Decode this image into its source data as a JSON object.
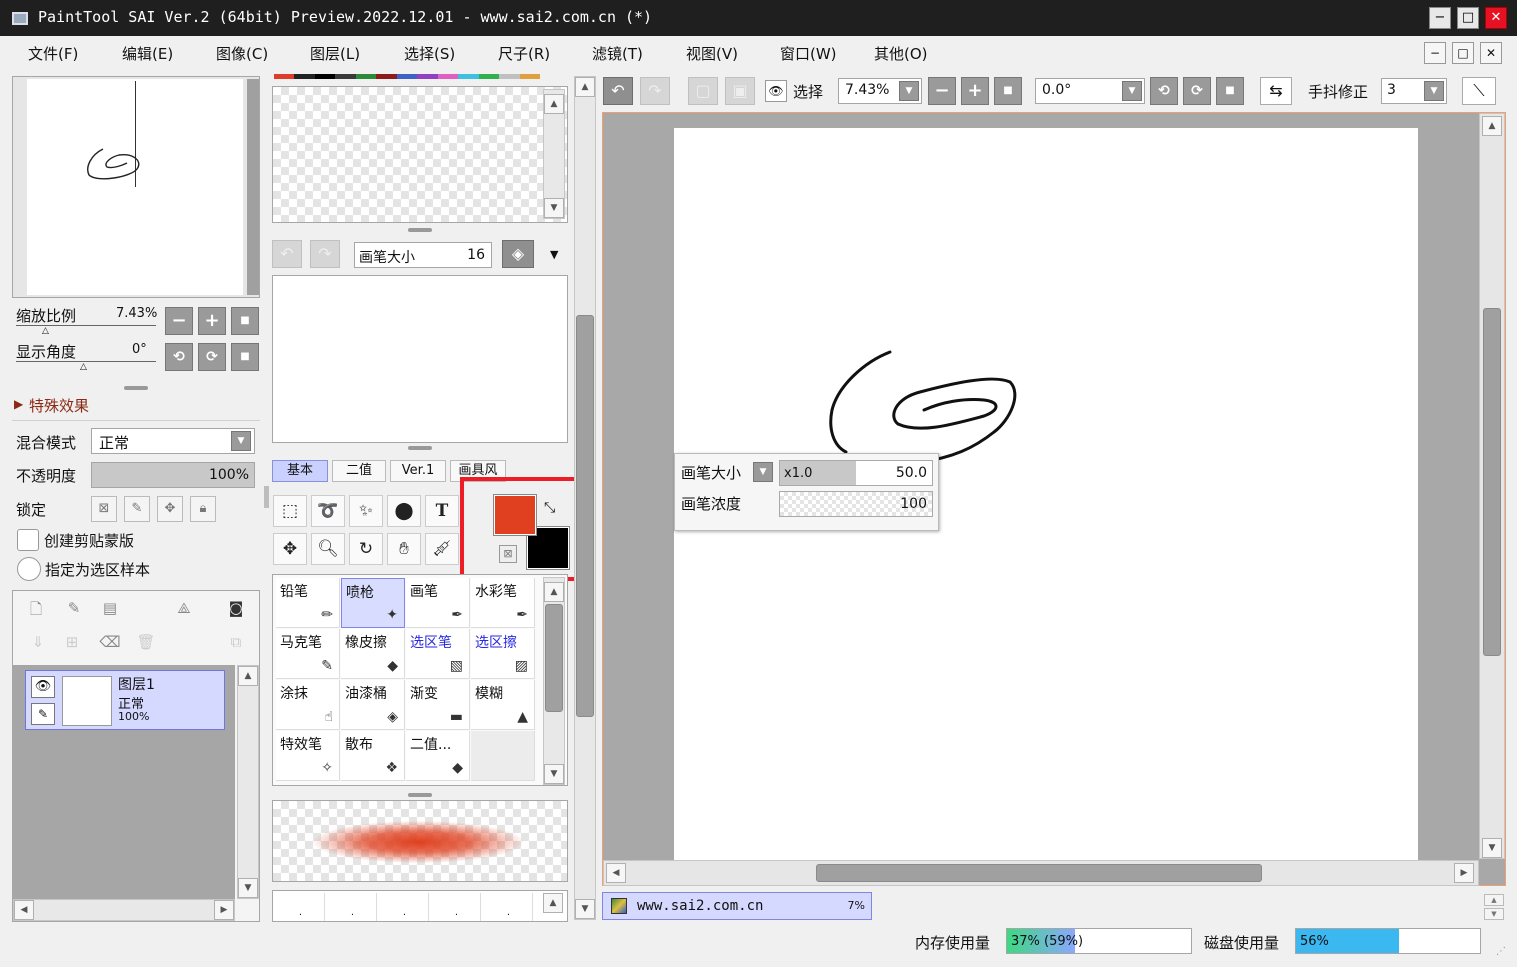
{
  "window": {
    "title": "PaintTool SAI Ver.2 (64bit) Preview.2022.12.01 - www.sai2.com.cn (*)",
    "min_glyph": "−",
    "max_glyph": "□",
    "close_glyph": "✕"
  },
  "menu": [
    "文件(F)",
    "编辑(E)",
    "图像(C)",
    "图层(L)",
    "选择(S)",
    "尺子(R)",
    "滤镜(T)",
    "视图(V)",
    "窗口(W)",
    "其他(O)"
  ],
  "navigator": {
    "zoom_label": "缩放比例",
    "zoom_value": "7.43%",
    "angle_label": "显示角度",
    "angle_value": "0°"
  },
  "effects": {
    "label": "特殊效果"
  },
  "layer_props": {
    "blend_label": "混合模式",
    "blend_value": "正常",
    "opacity_label": "不透明度",
    "opacity_value": "100%",
    "opacity_level": 1.0,
    "lock_label": "锁定",
    "clip_label": "创建剪贴蒙版",
    "selsource_label": "指定为选区样本"
  },
  "layers": [
    {
      "name": "图层1",
      "mode": "正常",
      "opacity": "100%"
    }
  ],
  "brush_header": {
    "size_label": "画笔大小",
    "size_value": "16"
  },
  "tool_tabs": [
    "基本",
    "二值",
    "Ver.1",
    "画具风"
  ],
  "colors": {
    "primary": "#e0401f",
    "secondary": "#000000",
    "highlight": "#ee1c25"
  },
  "palette": [
    "#e03c2c",
    "#222222",
    "#000000",
    "#3a3a3a",
    "#2a8a3a",
    "#8c1c1c",
    "#4060c8",
    "#9040c0",
    "#e060c0",
    "#40c0e0",
    "#30b050",
    "#c0c0c0",
    "#e0a040"
  ],
  "brushes": [
    {
      "name": "铅笔",
      "icon": "✏"
    },
    {
      "name": "喷枪",
      "icon": "✦"
    },
    {
      "name": "画笔",
      "icon": "✒"
    },
    {
      "name": "水彩笔",
      "icon": "✒"
    },
    {
      "name": "马克笔",
      "icon": "✎"
    },
    {
      "name": "橡皮擦",
      "icon": "◆"
    },
    {
      "name": "选区笔",
      "icon": "▧"
    },
    {
      "name": "选区擦",
      "icon": "▨"
    },
    {
      "name": "涂抹",
      "icon": "☝"
    },
    {
      "name": "油漆桶",
      "icon": "◈"
    },
    {
      "name": "渐变",
      "icon": "▬"
    },
    {
      "name": "模糊",
      "icon": "▲"
    },
    {
      "name": "特效笔",
      "icon": "✧"
    },
    {
      "name": "散布",
      "icon": "❖"
    },
    {
      "name": "二值...",
      "icon": "◆"
    }
  ],
  "toolbar": {
    "select_label": "选择",
    "zoom_value": "7.43%",
    "angle_value": "0.0°",
    "stabilizer_label": "手抖修正",
    "stabilizer_value": "3"
  },
  "brush_popup": {
    "size_label": "画笔大小",
    "mult": "x1.0",
    "size_value": "50.0",
    "density_label": "画笔浓度",
    "density_value": "100"
  },
  "doc_tab": {
    "name": "www.sai2.com.cn",
    "zoom": "7%"
  },
  "status": {
    "mem_label": "内存使用量",
    "mem_value": "37% (59%)",
    "mem_level": 0.37,
    "disk_label": "磁盘使用量",
    "disk_value": "56%",
    "disk_level": 0.56
  }
}
